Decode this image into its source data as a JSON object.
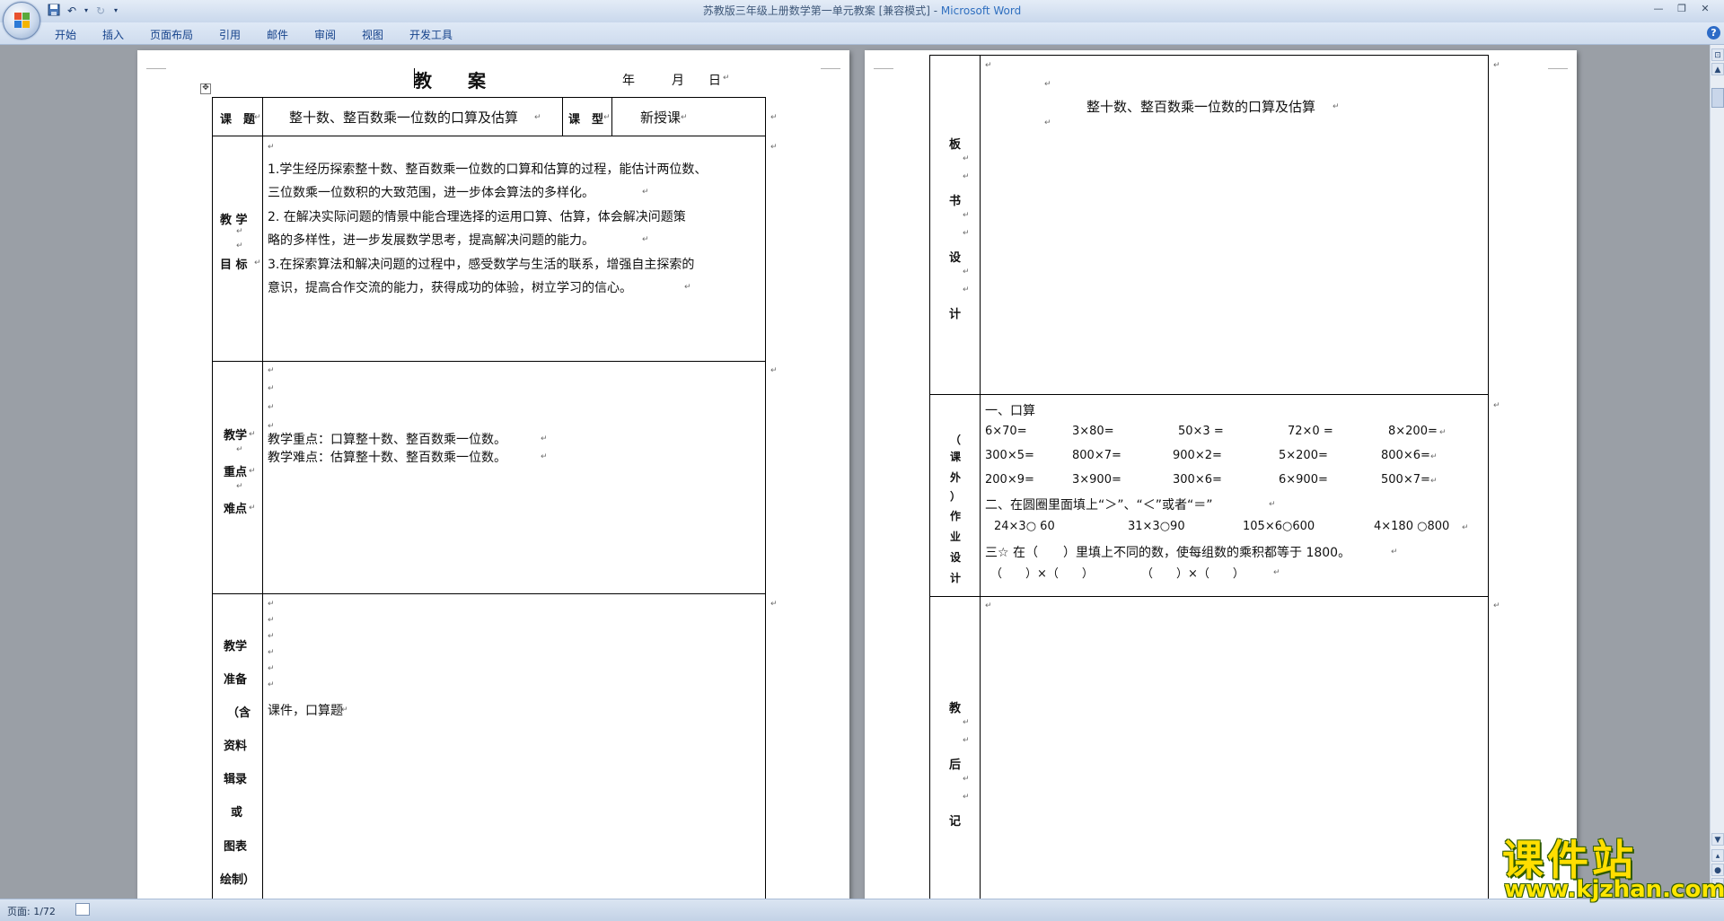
{
  "window": {
    "title_doc": "苏教版三年级上册数学第一单元教案 [兼容模式] - ",
    "title_app": "Microsoft Word"
  },
  "ribbon": {
    "tabs": [
      "开始",
      "插入",
      "页面布局",
      "引用",
      "邮件",
      "审阅",
      "视图",
      "开发工具"
    ]
  },
  "page1": {
    "heading": "教　　案",
    "date_year": "年",
    "date_month": "月",
    "date_day": "日",
    "row_topic": {
      "label": "课　题",
      "value": "整十数、整百数乘一位数的口算及估算",
      "type_label": "课　型",
      "type_value": "新授课"
    },
    "row_goals": {
      "label_1": "教 学",
      "label_2": "目 标",
      "lines": [
        "1.学生经历探索整十数、整百数乘一位数的口算和估算的过程，能估计两位数、",
        "三位数乘一位数积的大致范围，进一步体会算法的多样化。",
        "2. 在解决实际问题的情景中能合理选择的运用口算、估算，体会解决问题策",
        "略的多样性，进一步发展数学思考，提高解决问题的能力。",
        "3.在探索算法和解决问题的过程中，感受数学与生活的联系，增强自主探索的",
        "意识，提高合作交流的能力，获得成功的体验，树立学习的信心。"
      ]
    },
    "row_key": {
      "label_1": "教学",
      "label_2": "重点",
      "label_3": "难点",
      "line_1": "教学重点：口算整十数、整百数乘一位数。",
      "line_2": "教学难点：估算整十数、整百数乘一位数。"
    },
    "row_prep": {
      "labels": [
        "教学",
        "准备",
        "（含",
        "资料",
        "辑录",
        "或",
        "图表",
        "绘制）"
      ],
      "value": "课件，口算题"
    }
  },
  "page2": {
    "board": {
      "labels": [
        "板",
        "书",
        "设",
        "计"
      ],
      "title": "整十数、整百数乘一位数的口算及估算"
    },
    "homework": {
      "labels": [
        "（",
        "课",
        "外",
        "）",
        "作",
        "业",
        "设",
        "计"
      ],
      "section1": "一、口算",
      "row1": [
        "6×70=",
        "3×80=",
        "50×3 =",
        "72×0 =",
        "8×200="
      ],
      "row2": [
        "300×5=",
        "800×7=",
        "900×2=",
        "5×200=",
        "800×6="
      ],
      "row3": [
        "200×9=",
        "3×900=",
        "300×6=",
        "6×900=",
        "500×7="
      ],
      "section2": "二、在圆圈里面填上“＞”、“＜”或者“＝”",
      "compare": [
        "24×3○ 60",
        "31×3○90",
        "105×6○600",
        "4×180 ○800"
      ],
      "section3": "三☆ 在（　　）里填上不同的数，使每组数的乘积都等于 1800。",
      "blanks_1": "（　　）×（　　）",
      "blanks_2": "（　　）×（　　）"
    },
    "after": {
      "labels": [
        "教",
        "后",
        "记"
      ]
    }
  },
  "status": {
    "page": "页面: 1/72"
  },
  "watermark": {
    "cn": "课件站",
    "url": "www.kjzhan.com"
  }
}
